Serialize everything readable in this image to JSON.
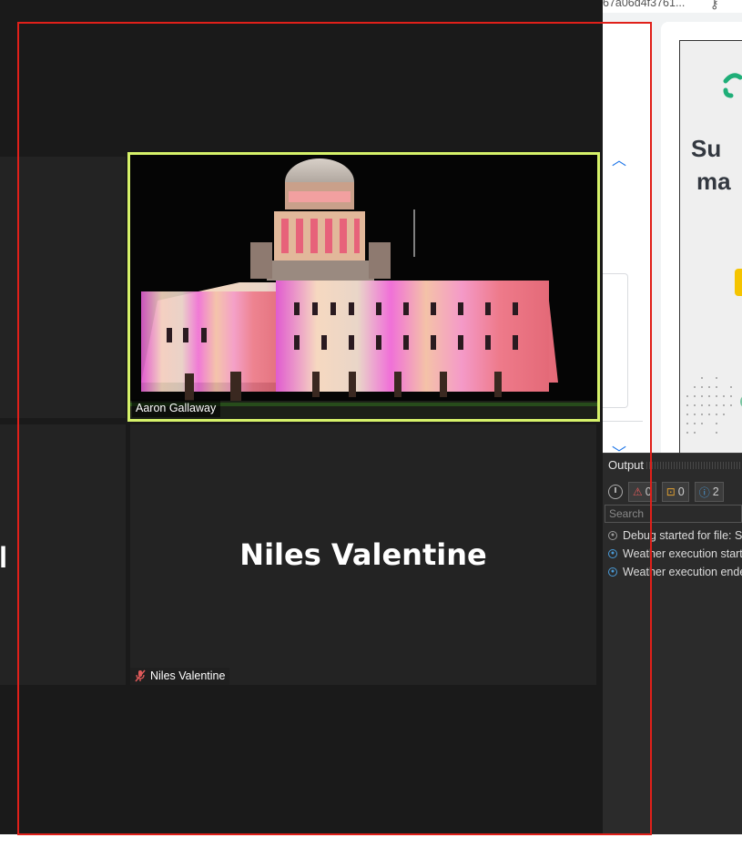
{
  "meeting": {
    "active_speaker": "Aaron Gallaway",
    "participant_niles_big": "Niles Valentine",
    "participant_niles_tag": "Niles Valentine",
    "left_tile_partial": "l"
  },
  "browser": {
    "url_fragment": "67a06d4f3761...",
    "ad_headline_line1": "Su",
    "ad_headline_line2": "ma"
  },
  "output_panel": {
    "title": "Output",
    "filters": [
      {
        "icon": "warning-icon",
        "count": "0"
      },
      {
        "icon": "error-icon",
        "count": "0"
      },
      {
        "icon": "info-icon",
        "count": "2"
      }
    ],
    "search_placeholder": "Search",
    "log": [
      {
        "type": "debug",
        "text": "Debug started for file: Se"
      },
      {
        "type": "info",
        "text": "Weather execution starte"
      },
      {
        "type": "info",
        "text": "Weather execution endec"
      }
    ]
  },
  "colors": {
    "active_speaker_border": "#d6f26a",
    "selection_outline": "#e0201a",
    "meeting_background": "#1a1a1a"
  }
}
